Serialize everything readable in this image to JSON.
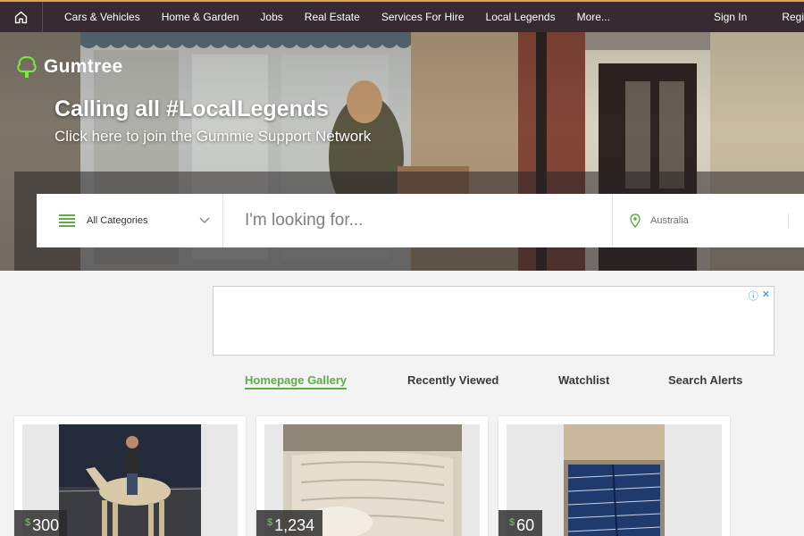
{
  "nav": {
    "home_icon": "home-icon",
    "items": [
      "Cars & Vehicles",
      "Home & Garden",
      "Jobs",
      "Real Estate",
      "Services For Hire",
      "Local Legends",
      "More..."
    ],
    "sign_in": "Sign In",
    "register": "Regi"
  },
  "brand": {
    "name": "Gumtree",
    "logo_icon": "tree-icon",
    "color": "#72ef36"
  },
  "hero": {
    "headline": "Calling all #LocalLegends",
    "subline": "Click here to join the Gummie Support Network"
  },
  "search": {
    "category_label": "All Categories",
    "query_placeholder": "I'm looking for...",
    "location_label": "Australia"
  },
  "ad": {
    "info_icon": "info-icon",
    "close_icon": "close-icon"
  },
  "tabs": [
    {
      "label": "Homepage Gallery",
      "active": true
    },
    {
      "label": "Recently Viewed",
      "active": false
    },
    {
      "label": "Watchlist",
      "active": false
    },
    {
      "label": "Search Alerts",
      "active": false
    }
  ],
  "listings": [
    {
      "currency": "$",
      "price": "300"
    },
    {
      "currency": "$",
      "price": "1,234"
    },
    {
      "currency": "$",
      "price": "60"
    }
  ],
  "colors": {
    "accent": "#5ead45",
    "nav_bg": "#372b31"
  }
}
